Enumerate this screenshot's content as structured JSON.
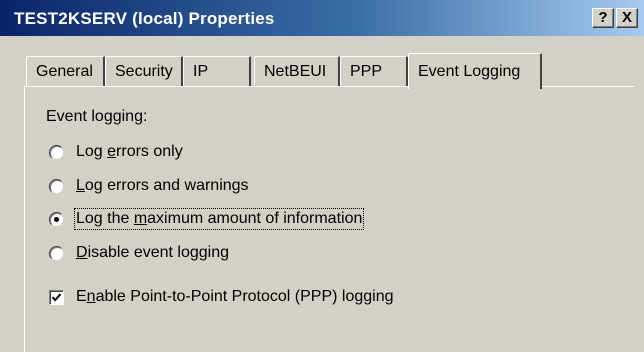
{
  "window": {
    "title": "TEST2KSERV (local) Properties",
    "help_button": "?",
    "close_button": "X"
  },
  "tabs": [
    {
      "label": "General"
    },
    {
      "label": "Security"
    },
    {
      "label": "IP"
    },
    {
      "label": "NetBEUI"
    },
    {
      "label": "PPP"
    },
    {
      "label": "Event Logging",
      "active": true
    }
  ],
  "event_logging": {
    "group_label": "Event logging:",
    "options": [
      {
        "label_pre": "Log ",
        "label_u": "e",
        "label_post": "rrors only",
        "checked": false
      },
      {
        "label_pre": "",
        "label_u": "L",
        "label_post": "og errors and warnings",
        "checked": false
      },
      {
        "label_pre": "Log the ",
        "label_u": "m",
        "label_post": "aximum amount of information",
        "checked": true
      },
      {
        "label_pre": "",
        "label_u": "D",
        "label_post": "isable event logging",
        "checked": false
      }
    ],
    "ppp_logging": {
      "label_pre": "E",
      "label_u": "n",
      "label_post": "able Point-to-Point Protocol (PPP) logging",
      "checked": true
    }
  }
}
